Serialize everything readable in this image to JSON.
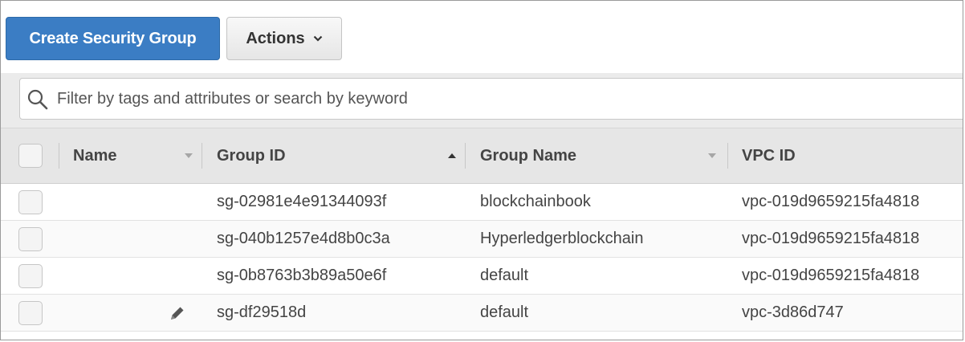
{
  "toolbar": {
    "create_label": "Create Security Group",
    "actions_label": "Actions"
  },
  "filter": {
    "placeholder": "Filter by tags and attributes or search by keyword",
    "value": ""
  },
  "table": {
    "columns": [
      {
        "label": "Name",
        "sort": "none"
      },
      {
        "label": "Group ID",
        "sort": "ascending"
      },
      {
        "label": "Group Name",
        "sort": "none"
      },
      {
        "label": "VPC ID",
        "sort": "none"
      }
    ],
    "rows": [
      {
        "name": "",
        "group_id": "sg-02981e4e91344093f",
        "group_name": "blockchainbook",
        "vpc_id": "vpc-019d9659215fa4818",
        "editable": false
      },
      {
        "name": "",
        "group_id": "sg-040b1257e4d8b0c3a",
        "group_name": "Hyperledgerblockchain",
        "vpc_id": "vpc-019d9659215fa4818",
        "editable": false
      },
      {
        "name": "",
        "group_id": "sg-0b8763b3b89a50e6f",
        "group_name": "default",
        "vpc_id": "vpc-019d9659215fa4818",
        "editable": false
      },
      {
        "name": "",
        "group_id": "sg-df29518d",
        "group_name": "default",
        "vpc_id": "vpc-3d86d747",
        "editable": true
      }
    ]
  },
  "icons": {
    "search": "search-icon",
    "actions_chevron": "chevron-down-icon",
    "sort_down": "sort-down-icon",
    "sort_up": "sort-up-icon",
    "edit": "pencil-icon"
  },
  "colors": {
    "primary": "#3b7dc4",
    "header_bg": "#e6e6e6",
    "filter_band_bg": "#ebebeb",
    "text": "#444444"
  }
}
